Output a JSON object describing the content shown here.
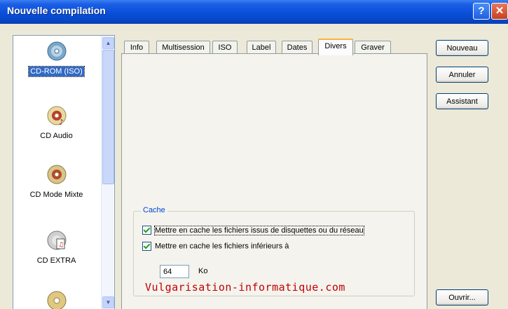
{
  "window": {
    "title": "Nouvelle compilation"
  },
  "titlebar": {
    "help_glyph": "?",
    "close_glyph": "✕"
  },
  "compilation_types": [
    {
      "label": "CD-ROM (ISO)",
      "icon": "cd-data-icon",
      "selected": true
    },
    {
      "label": "CD Audio",
      "icon": "cd-audio-icon",
      "selected": false
    },
    {
      "label": "CD Mode Mixte",
      "icon": "cd-mixed-icon",
      "selected": false
    },
    {
      "label": "CD EXTRA",
      "icon": "cd-extra-icon",
      "selected": false
    },
    {
      "label": "",
      "icon": "cd-icon",
      "selected": false
    }
  ],
  "tabs": [
    {
      "label": "Info",
      "active": false
    },
    {
      "label": "Multisession",
      "active": false
    },
    {
      "label": "ISO",
      "active": false
    },
    {
      "label": "Label",
      "active": false
    },
    {
      "label": "Dates",
      "active": false
    },
    {
      "label": "Divers",
      "active": true
    },
    {
      "label": "Graver",
      "active": false
    }
  ],
  "cache": {
    "title": "Cache",
    "option1": {
      "label": "Mettre en cache les fichiers issus de disquettes ou du réseau",
      "checked": true
    },
    "option2": {
      "label": "Mettre en cache les fichiers inférieurs à",
      "checked": true
    },
    "size_value": "64",
    "size_unit": "Ko"
  },
  "watermark": "Vulgarisation-informatique.com",
  "buttons": {
    "new": "Nouveau",
    "cancel": "Annuler",
    "wizard": "Assistant",
    "open": "Ouvrir..."
  },
  "colors": {
    "titlebar": "#0a4fd8",
    "selection": "#316ac5",
    "group_title": "#0046d5",
    "watermark": "#c00000",
    "active_tab_accent": "#f7b439"
  }
}
